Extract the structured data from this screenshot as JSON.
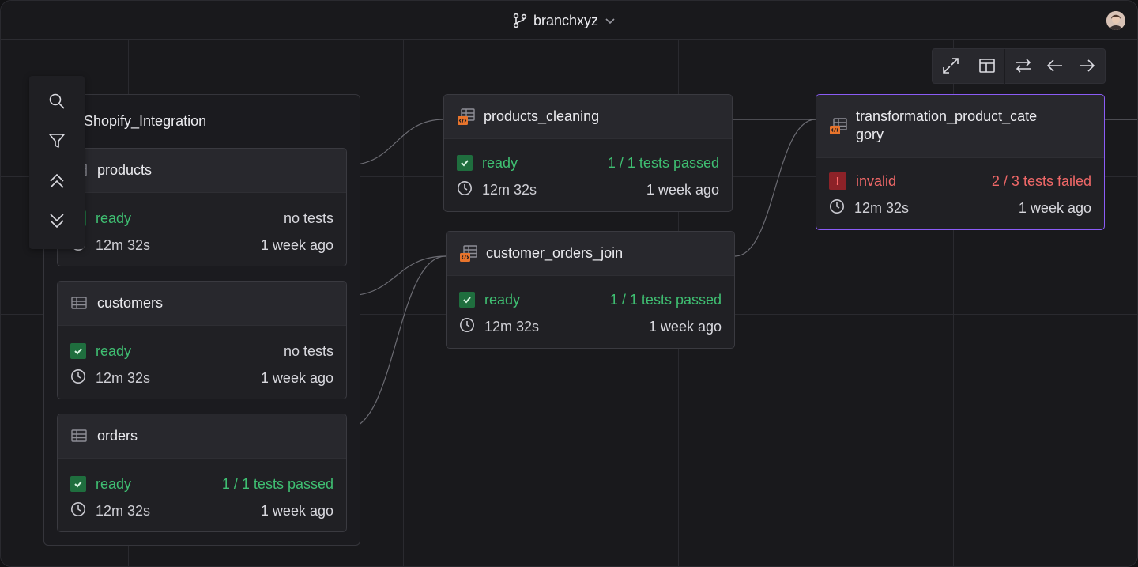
{
  "topbar": {
    "branch_name": "branchxyz",
    "branch_icon": "git-branch-icon",
    "chevron_icon": "chevron-down-icon",
    "avatar_icon": "user-avatar"
  },
  "toolbar": {
    "buttons": [
      "expand-icon",
      "layout-icon",
      "swap-icon",
      "arrow-left-icon",
      "arrow-right-icon"
    ]
  },
  "sidebar": {
    "buttons": [
      "search-icon",
      "filter-icon",
      "chevrons-up-icon",
      "chevrons-down-icon"
    ]
  },
  "group": {
    "title": "Shopify_Integration"
  },
  "nodes": {
    "products": {
      "title": "products",
      "status": "ready",
      "tests": "no tests",
      "duration": "12m 32s",
      "updated": "1 week ago"
    },
    "customers": {
      "title": "customers",
      "status": "ready",
      "tests": "no tests",
      "duration": "12m 32s",
      "updated": "1 week ago"
    },
    "orders": {
      "title": "orders",
      "status": "ready",
      "tests": "1 / 1 tests passed",
      "duration": "12m 32s",
      "updated": "1 week ago"
    },
    "products_cleaning": {
      "title": "products_cleaning",
      "status": "ready",
      "tests": "1 / 1 tests passed",
      "duration": "12m 32s",
      "updated": "1 week ago"
    },
    "customer_orders_join": {
      "title": "customer_orders_join",
      "status": "ready",
      "tests": "1 / 1 tests passed",
      "duration": "12m 32s",
      "updated": "1 week ago"
    },
    "transformation": {
      "title_line1": "transformation_product_cate",
      "title_line2": "gory",
      "status": "invalid",
      "tests": "2 / 3 tests failed",
      "duration": "12m 32s",
      "updated": "1 week ago"
    }
  },
  "colors": {
    "ready": "#3fbf72",
    "invalid": "#f06868",
    "selected_border": "#8b5cf6",
    "transform_icon": "#e8742c"
  }
}
